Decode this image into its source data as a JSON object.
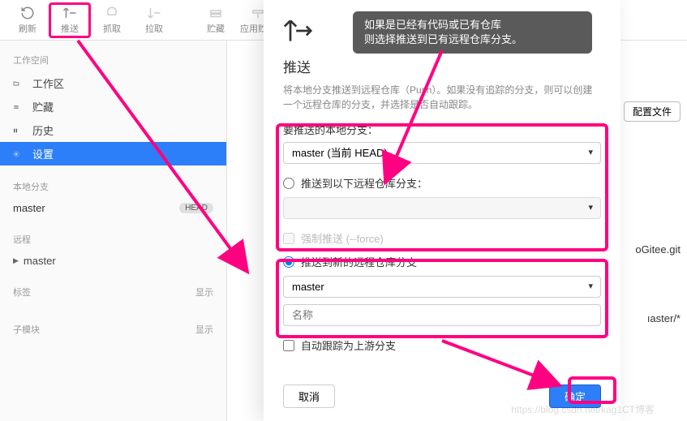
{
  "toolbar": {
    "items": [
      {
        "label": "刷新",
        "icon": "refresh"
      },
      {
        "label": "推送",
        "icon": "push"
      },
      {
        "label": "抓取",
        "icon": "fetch"
      },
      {
        "label": "拉取",
        "icon": "pull"
      },
      {
        "label": "贮藏",
        "icon": "stash"
      },
      {
        "label": "应用贮藏",
        "icon": "apply-stash"
      }
    ]
  },
  "sidebar": {
    "workspace_title": "工作空间",
    "workspace_items": [
      {
        "label": "工作区",
        "icon": "folder"
      },
      {
        "label": "贮藏",
        "icon": "stack"
      },
      {
        "label": "历史",
        "icon": "history"
      },
      {
        "label": "设置",
        "icon": "gear"
      }
    ],
    "local_branches_title": "本地分支",
    "local_branch": "master",
    "head_badge": "HEAD",
    "remotes_title": "远程",
    "remote_item": "master",
    "tags_title": "标签",
    "tags_action": "显示",
    "submodules_title": "子模块",
    "submodules_action": "显示"
  },
  "main": {
    "config_button": "配置文件",
    "peek_text1": "oGitee.git",
    "peek_text2": "ıaster/*"
  },
  "modal": {
    "title": "推送",
    "description": "将本地分支推送到远程仓库（Push）。如果没有追踪的分支，则可以创建一个远程仓库的分支，并选择是否自动跟踪。",
    "local_branch_label": "要推送的本地分支：",
    "local_branch_value": "master (当前 HEAD)",
    "push_existing_label": "推送到以下远程仓库分支：",
    "force_push_label": "强制推送 (--force)",
    "push_new_label": "推送到新的远程仓库分支",
    "new_branch_value": "master",
    "name_placeholder": "名称",
    "auto_track_label": "自动跟踪为上游分支",
    "cancel": "取消",
    "confirm": "确定"
  },
  "annotation": {
    "tip_line1": "如果是已经有代码或已有仓库",
    "tip_line2": "则选择推送到已有远程仓库分支。"
  },
  "watermark": "https://blog.csdn.net/kag1CT博客"
}
